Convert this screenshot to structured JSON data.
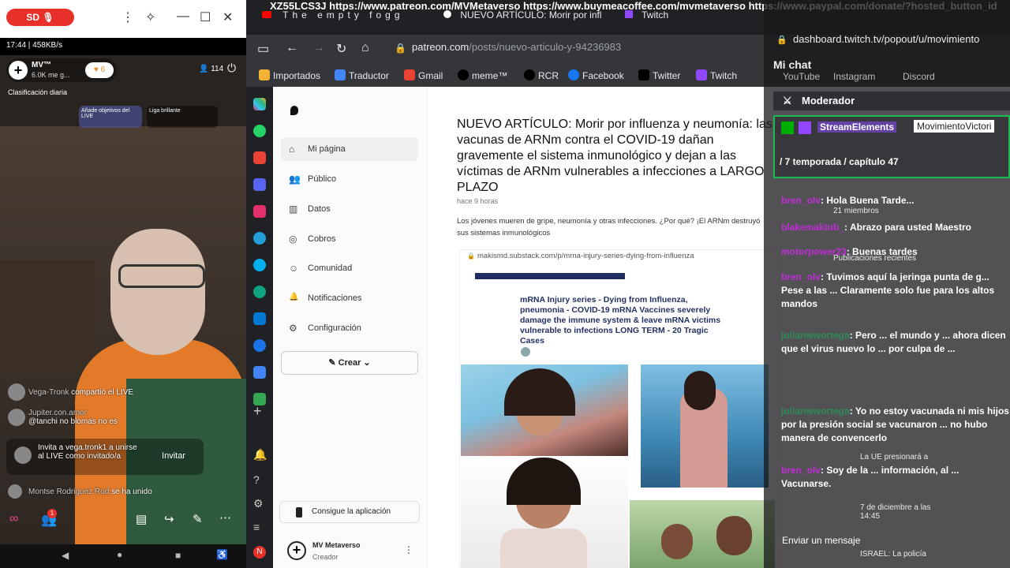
{
  "phone": {
    "record_pill": "SD",
    "status_left": "17:44 | 458KB/s",
    "live_name": "MV™",
    "live_followers": "6.0K me g...",
    "heart_count": "6",
    "viewers": "114",
    "ranking": "Clasificación diaria",
    "goal_text": "Añade objetivos del LIVE",
    "league_text": "Liga brillante",
    "chat": [
      {
        "name": "Vega-Tronk",
        "text": "compartió el LIVE"
      },
      {
        "name": "Jupiter.con.amor",
        "text": "@tanchi no blomas no es"
      },
      {
        "name": "",
        "text": "Invita a vega.tronk1 a unirse al LIVE como invitado/a"
      },
      {
        "name": "Montse Rodriguez Rod",
        "text": "se ha unido"
      }
    ],
    "invite_label": "Invitar",
    "badge_count": "1"
  },
  "browser": {
    "ticker": "XZ55LCS3J https://www.patreon.com/MVMetaverso https://www.buymeacoffee.com/mvmetaverso https://www.paypal.com/donate/?hosted_button_id",
    "tabs": [
      {
        "label": "The empty fogg"
      },
      {
        "label": "NUEVO ARTÍCULO: Morir por infl"
      },
      {
        "label": "Twitch"
      }
    ],
    "url_host": "patreon.com",
    "url_path": "/posts/nuevo-articulo-y-94236983",
    "bookmarks": [
      {
        "label": "Importados",
        "color": "#f2b233"
      },
      {
        "label": "Traductor",
        "color": "#4285f4"
      },
      {
        "label": "Gmail",
        "color": "#ea4335"
      },
      {
        "label": "meme™",
        "color": "#000000"
      },
      {
        "label": "RCR",
        "color": "#000000"
      },
      {
        "label": "Facebook",
        "color": "#1877f2"
      },
      {
        "label": "Twitter",
        "color": "#000000"
      },
      {
        "label": "Twitch",
        "color": "#9146ff"
      }
    ]
  },
  "patreon": {
    "nav": [
      {
        "label": "Mi página",
        "icon": "⌂"
      },
      {
        "label": "Público",
        "icon": "👥"
      },
      {
        "label": "Datos",
        "icon": "▥"
      },
      {
        "label": "Cobros",
        "icon": "◎"
      },
      {
        "label": "Comunidad",
        "icon": "☺"
      },
      {
        "label": "Notificaciones",
        "icon": "🔔"
      },
      {
        "label": "Configuración",
        "icon": "⚙"
      }
    ],
    "create_label": "Crear",
    "app_label": "Consigue la aplicación",
    "creator_name": "MV Metaverso",
    "creator_role": "Creador"
  },
  "article": {
    "title": "NUEVO ARTÍCULO: Morir por influenza y neumonía: las vacunas de ARNm contra el COVID-19 dañan gravemente el sistema inmunológico y dejan a las víctimas de ARNm vulnerables a infecciones a LARGO PLAZO",
    "time": "hace 9 horas",
    "lead": "Los jóvenes mueren de gripe, neumonía y otras infecciones. ¿Por qué? ¡El ARNm destruyó sus sistemas inmunológicos",
    "embed_url": "makismd.substack.com/p/mrna-injury-series-dying-from-influenza",
    "embed_title": "mRNA Injury series - Dying from Influenza, pneumonia - COVID-19 mRNA Vaccines severely damage the immune system & leave mRNA victims vulnerable to infections LONG TERM - 20 Tragic Cases"
  },
  "twitch": {
    "url": "dashboard.twitch.tv/popout/u/movimiento",
    "title": "Mi chat",
    "top_tabs": [
      "YouTube",
      "Instagram",
      "Discord"
    ],
    "moderator": "Moderador",
    "pinned_user": "StreamElements",
    "pinned_tag": "MovimientoVictori",
    "pinned_text": "/ 7 temporada / capítulo 47",
    "messages": [
      {
        "user": "bren_olv",
        "text": "Hola Buena Tarde..."
      },
      {
        "user": "blakemaktub_",
        "text": "Abrazo para usted Maestro"
      },
      {
        "user": "motorpower23",
        "text": "Buenas tardes"
      },
      {
        "user": "bren_olv",
        "text": "Tuvimos aquí la jeringa punta de g... Pese a las ... Claramente solo fue para los altos mandos"
      },
      {
        "user": "julianwwortega",
        "text": "Pero ... el mundo y ... ahora dicen que el virus nuevo lo ... por culpa de ..."
      },
      {
        "user": "julianwwortega",
        "text": "Yo no estoy vacunada ni mis hijos por la presión social se vacunaron ... no hubo manera de convencerlo"
      },
      {
        "user": "bren_olv",
        "text": "Soy de la ... información, al ... Vacunarse."
      }
    ],
    "ghost": {
      "members": "21 miembros",
      "recent": "Publicaciones recientes",
      "date": "7 de diciembre a las 14:45",
      "news1": "La UE presionará a",
      "news2": "ISRAEL: La policía"
    },
    "send_label": "Enviar un mensaje"
  }
}
